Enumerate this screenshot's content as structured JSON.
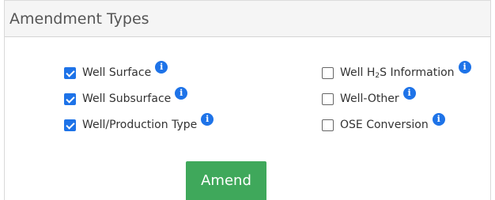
{
  "panel": {
    "title": "Amendment Types"
  },
  "options_left": [
    {
      "label": "Well Surface",
      "checked": true,
      "info_icon": "info-circle-icon"
    },
    {
      "label": "Well Subsurface",
      "checked": true,
      "info_icon": "info-circle-icon"
    },
    {
      "label": "Well/Production Type",
      "checked": true,
      "info_icon": "info-circle-icon"
    }
  ],
  "options_right": [
    {
      "label_pre": "Well H",
      "label_sub": "2",
      "label_post": "S Information",
      "checked": false,
      "info_icon": "info-circle-icon"
    },
    {
      "label": "Well-Other",
      "checked": false,
      "info_icon": "info-circle-icon"
    },
    {
      "label": "OSE Conversion",
      "checked": false,
      "info_icon": "info-circle-icon"
    }
  ],
  "info_glyph": "i",
  "actions": {
    "amend_label": "Amend"
  },
  "colors": {
    "accent_blue": "#1e73e8",
    "button_green": "#3fa85b",
    "header_bg": "#f5f5f5"
  }
}
